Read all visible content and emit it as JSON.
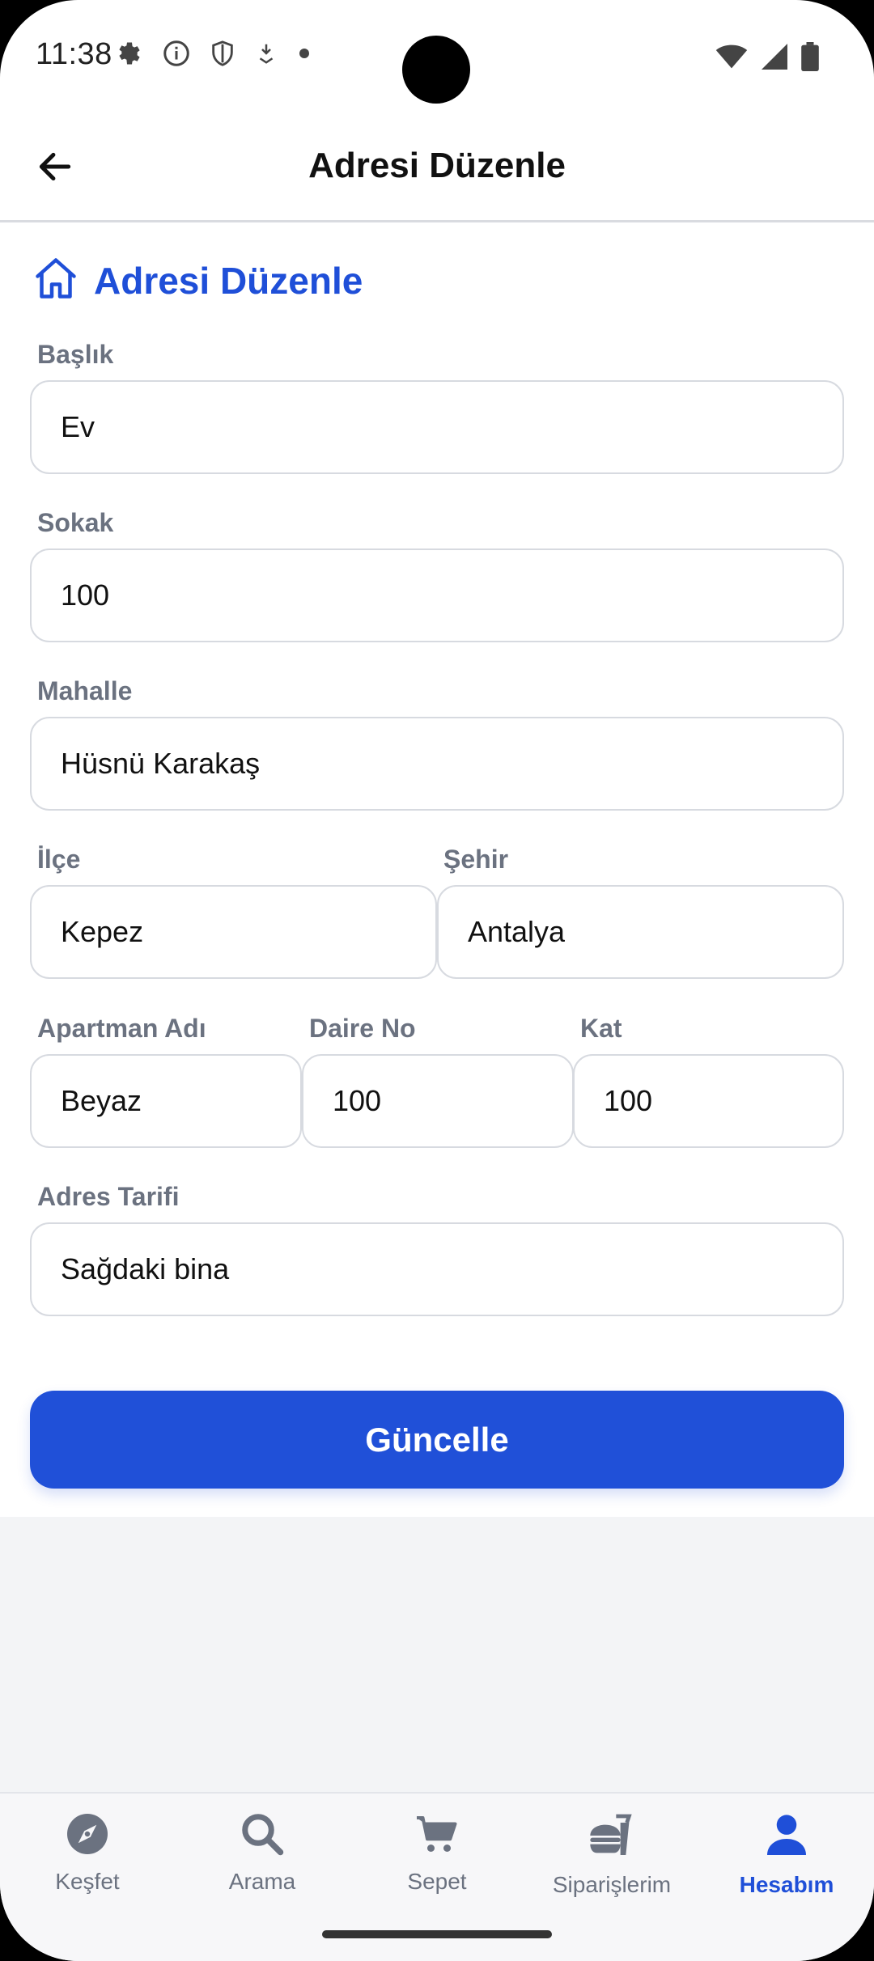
{
  "status_bar": {
    "time": "11:38",
    "icons": [
      "gear-icon",
      "info-icon",
      "shield-icon",
      "download-icon",
      "dot-icon"
    ],
    "right_icons": [
      "wifi-icon",
      "signal-icon",
      "battery-icon"
    ]
  },
  "app_bar": {
    "back_icon": "arrow-left-icon",
    "title": "Adresi Düzenle"
  },
  "section": {
    "icon": "home-icon",
    "title": "Adresi Düzenle"
  },
  "form": {
    "baslik": {
      "label": "Başlık",
      "value": "Ev"
    },
    "sokak": {
      "label": "Sokak",
      "value": "100"
    },
    "mahalle": {
      "label": "Mahalle",
      "value": "Hüsnü Karakaş"
    },
    "ilce": {
      "label": "İlçe",
      "value": "Kepez"
    },
    "sehir": {
      "label": "Şehir",
      "value": "Antalya"
    },
    "apartman": {
      "label": "Apartman Adı",
      "value": "Beyaz"
    },
    "daire": {
      "label": "Daire No",
      "value": "100"
    },
    "kat": {
      "label": "Kat",
      "value": "100"
    },
    "tarif": {
      "label": "Adres Tarifi",
      "value": "Sağdaki bina"
    },
    "submit_label": "Güncelle"
  },
  "bottom_nav": {
    "items": [
      {
        "label": "Keşfet",
        "icon": "compass-icon"
      },
      {
        "label": "Arama",
        "icon": "search-icon"
      },
      {
        "label": "Sepet",
        "icon": "cart-icon"
      },
      {
        "label": "Siparişlerim",
        "icon": "food-icon"
      },
      {
        "label": "Hesabım",
        "icon": "user-icon",
        "active": true
      }
    ]
  },
  "colors": {
    "accent": "#1f4fd8",
    "button": "#2050d8",
    "label_gray": "#6b7280",
    "border": "#d7dae0"
  }
}
